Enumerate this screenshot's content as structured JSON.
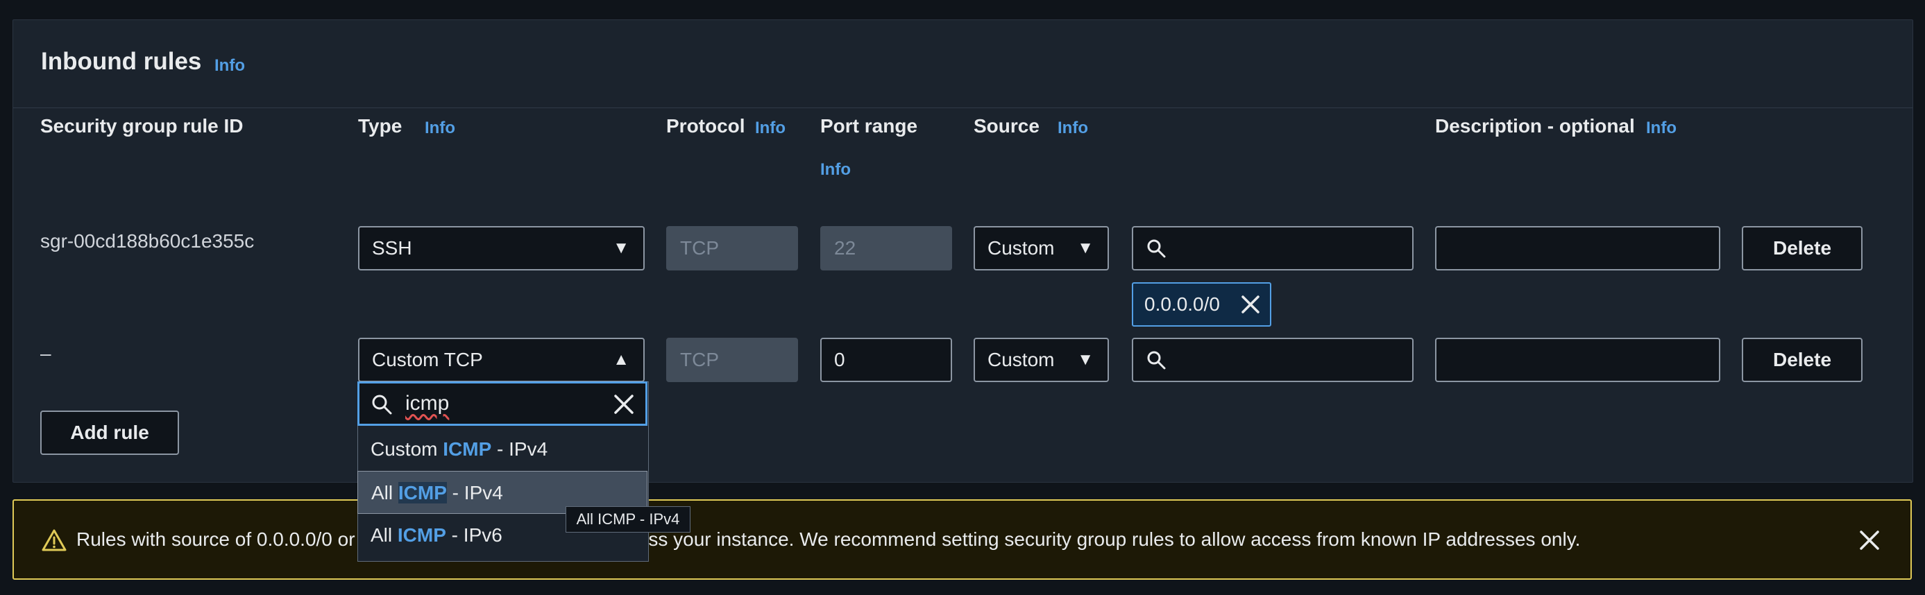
{
  "panel": {
    "title": "Inbound rules",
    "info": "Info"
  },
  "columns": {
    "rule_id": "Security group rule ID",
    "type": "Type",
    "protocol": "Protocol",
    "port_range": "Port range",
    "source": "Source",
    "description": "Description - optional",
    "info": "Info"
  },
  "rows": [
    {
      "rule_id": "sgr-00cd188b60c1e355c",
      "type": "SSH",
      "protocol": "TCP",
      "port_range": "22",
      "source": "Custom",
      "source_value": "",
      "description": "",
      "token": "0.0.0.0/0",
      "delete": "Delete"
    },
    {
      "rule_id": "–",
      "type": "Custom TCP",
      "protocol": "TCP",
      "port_range": "0",
      "source": "Custom",
      "source_value": "",
      "description": "",
      "delete": "Delete"
    }
  ],
  "add_rule": "Add rule",
  "type_dropdown": {
    "search_value": "icmp",
    "options": [
      {
        "prefix": "Custom ",
        "highlight": "ICMP",
        "suffix": " - IPv4"
      },
      {
        "prefix": "All ",
        "highlight": "ICMP",
        "suffix": " - IPv4"
      },
      {
        "prefix": "All ",
        "highlight": "ICMP",
        "suffix": " - IPv6"
      }
    ],
    "tooltip": "All ICMP - IPv4"
  },
  "alert": {
    "message": "Rules with source of 0.0.0.0/0 or ::/0 allow all IP addresses to access your instance. We recommend setting security group rules to allow access from known IP addresses only."
  },
  "colors": {
    "link": "#539fe5",
    "warning": "#e0ca57",
    "background": "#0f141a",
    "panel": "#1b232d"
  }
}
